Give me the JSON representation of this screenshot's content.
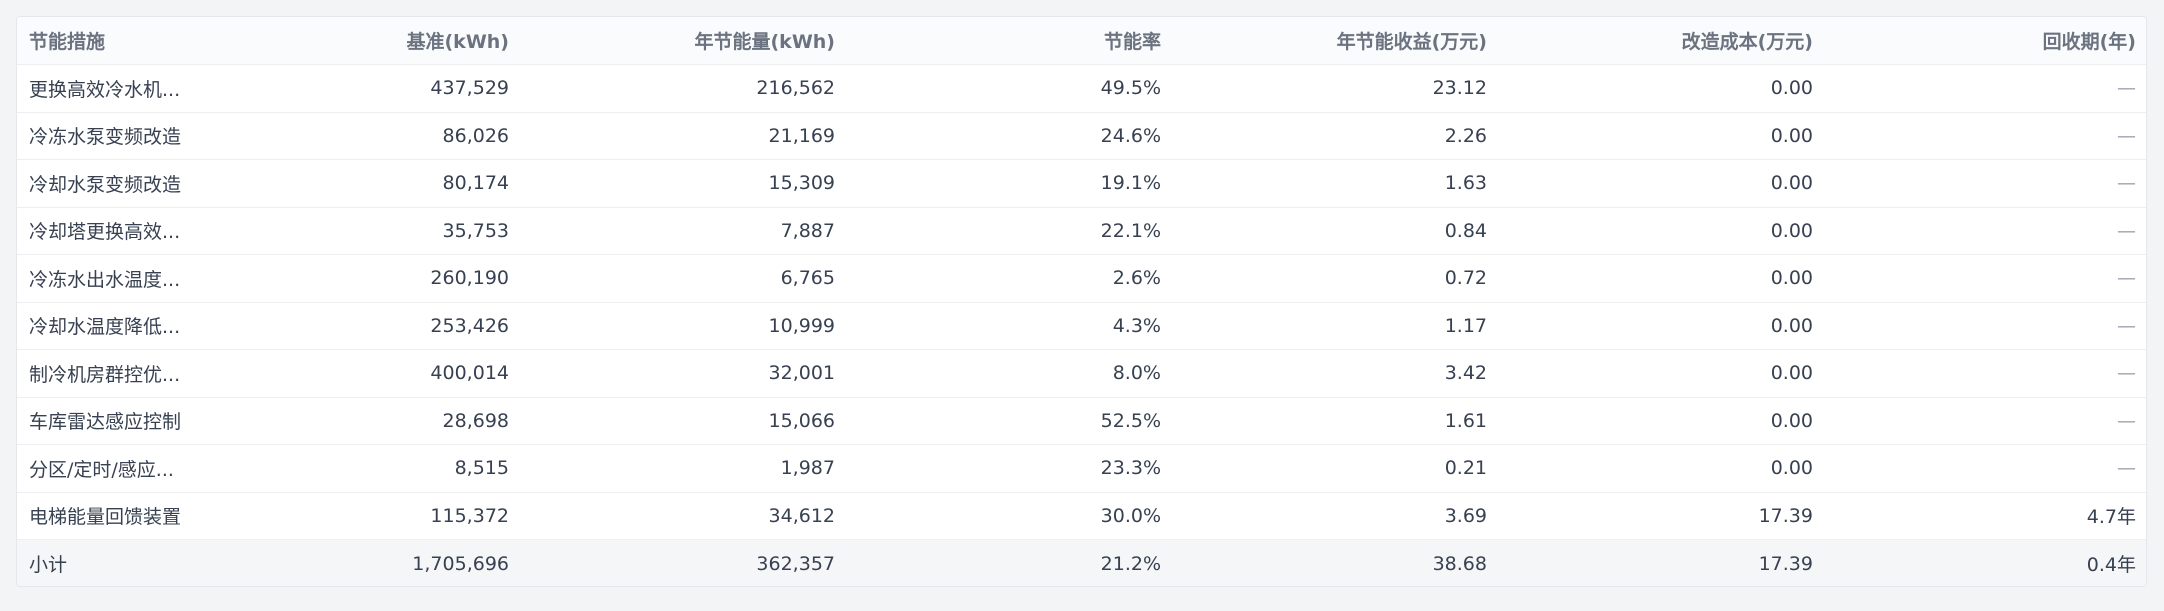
{
  "columns": [
    "节能措施",
    "基准(kWh)",
    "年节能量(kWh)",
    "节能率",
    "年节能收益(万元)",
    "改造成本(万元)",
    "回收期(年)"
  ],
  "rows": [
    [
      "更换高效冷水机...",
      "437,529",
      "216,562",
      "49.5%",
      "23.12",
      "0.00",
      "—"
    ],
    [
      "冷冻水泵变频改造",
      "86,026",
      "21,169",
      "24.6%",
      "2.26",
      "0.00",
      "—"
    ],
    [
      "冷却水泵变频改造",
      "80,174",
      "15,309",
      "19.1%",
      "1.63",
      "0.00",
      "—"
    ],
    [
      "冷却塔更换高效...",
      "35,753",
      "7,887",
      "22.1%",
      "0.84",
      "0.00",
      "—"
    ],
    [
      "冷冻水出水温度...",
      "260,190",
      "6,765",
      "2.6%",
      "0.72",
      "0.00",
      "—"
    ],
    [
      "冷却水温度降低...",
      "253,426",
      "10,999",
      "4.3%",
      "1.17",
      "0.00",
      "—"
    ],
    [
      "制冷机房群控优...",
      "400,014",
      "32,001",
      "8.0%",
      "3.42",
      "0.00",
      "—"
    ],
    [
      "车库雷达感应控制",
      "28,698",
      "15,066",
      "52.5%",
      "1.61",
      "0.00",
      "—"
    ],
    [
      "分区/定时/感应...",
      "8,515",
      "1,987",
      "23.3%",
      "0.21",
      "0.00",
      "—"
    ],
    [
      "电梯能量回馈装置",
      "115,372",
      "34,612",
      "30.0%",
      "3.69",
      "17.39",
      "4.7年"
    ]
  ],
  "total": [
    "小计",
    "1,705,696",
    "362,357",
    "21.2%",
    "38.68",
    "17.39",
    "0.4年"
  ]
}
